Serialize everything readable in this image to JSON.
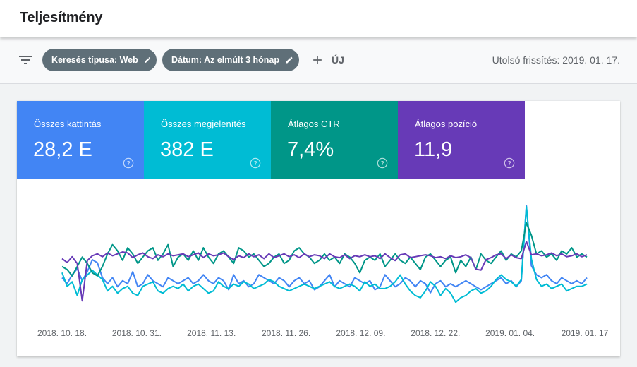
{
  "header": {
    "title": "Teljesítmény"
  },
  "toolbar": {
    "filter_icon": "filter-list-icon",
    "chips": [
      {
        "label": "Keresés típusa: Web",
        "icon": "edit-icon"
      },
      {
        "label": "Dátum: Az elmúlt 3 hónap",
        "icon": "edit-icon"
      }
    ],
    "add_label": "ÚJ",
    "last_updated": "Utolsó frissítés: 2019. 01. 17."
  },
  "metrics": [
    {
      "label": "Összes kattintás",
      "value": "28,2 E",
      "color": "#4285f4"
    },
    {
      "label": "Összes megjelenítés",
      "value": "382 E",
      "color": "#00bcd4"
    },
    {
      "label": "Átlagos CTR",
      "value": "7,4%",
      "color": "#009688"
    },
    {
      "label": "Átlagos pozíció",
      "value": "11,9",
      "color": "#673ab7"
    }
  ],
  "chart_data": {
    "type": "line",
    "x_tick_labels": [
      "2018. 10. 18.",
      "2018. 10. 31.",
      "2018. 11. 13.",
      "2018. 11. 26.",
      "2018. 12. 09.",
      "2018. 12. 22.",
      "2019. 01. 04.",
      "2019. 01. 17"
    ],
    "y_axis_visible": false,
    "grid": false,
    "series": [
      {
        "color": "#4285f4",
        "values": [
          74,
          72,
          75,
          77,
          73,
          76,
          80,
          79,
          74,
          72,
          74,
          71,
          73,
          72,
          76,
          71,
          72,
          75,
          73,
          72,
          71,
          74,
          73,
          72,
          73,
          74,
          72,
          73,
          75,
          73,
          72,
          74,
          73,
          70,
          75,
          72,
          73,
          71,
          72,
          75,
          74,
          73,
          72,
          74,
          73,
          71,
          73,
          74,
          72,
          73,
          70,
          71,
          73,
          75,
          71,
          73,
          72,
          71,
          74,
          73,
          72,
          73,
          70,
          71,
          75,
          73,
          71,
          72,
          74,
          73,
          71,
          73,
          72,
          69,
          72,
          73,
          71,
          72,
          71,
          72,
          73,
          72,
          71,
          70,
          71,
          72,
          73,
          74,
          72,
          73,
          71,
          73,
          98,
          78,
          75,
          74,
          75,
          73,
          72,
          74,
          73,
          72,
          73,
          72,
          74
        ]
      },
      {
        "color": "#00bcd4",
        "values": [
          86,
          80,
          82,
          76,
          83,
          85,
          87,
          85,
          83,
          78,
          80,
          77,
          79,
          80,
          77,
          76,
          80,
          81,
          82,
          78,
          77,
          79,
          80,
          79,
          81,
          78,
          80,
          81,
          79,
          77,
          78,
          82,
          80,
          79,
          81,
          80,
          82,
          81,
          79,
          80,
          81,
          83,
          82,
          80,
          79,
          78,
          79,
          80,
          81,
          80,
          79,
          80,
          81,
          82,
          80,
          79,
          80,
          81,
          80,
          78,
          82,
          80,
          81,
          79,
          79,
          80,
          82,
          85,
          81,
          78,
          76,
          75,
          78,
          82,
          80,
          76,
          79,
          77,
          73,
          75,
          76,
          78,
          79,
          77,
          78,
          80,
          83,
          85,
          83,
          82,
          80,
          83,
          115,
          92,
          83,
          80,
          81,
          79,
          80,
          81,
          78,
          79,
          80,
          80,
          81
        ]
      },
      {
        "color": "#009688",
        "values": [
          88,
          87,
          85,
          88,
          91,
          89,
          86,
          85,
          88,
          92,
          95,
          93,
          90,
          94,
          92,
          89,
          91,
          93,
          94,
          90,
          92,
          95,
          88,
          91,
          92,
          90,
          93,
          90,
          94,
          91,
          89,
          92,
          93,
          91,
          89,
          94,
          93,
          91,
          92,
          90,
          88,
          89,
          91,
          92,
          89,
          90,
          93,
          94,
          92,
          91,
          89,
          90,
          92,
          90,
          91,
          89,
          92,
          91,
          89,
          86,
          90,
          91,
          90,
          92,
          88,
          90,
          92,
          90,
          89,
          91,
          89,
          87,
          91,
          92,
          90,
          88,
          90,
          91,
          86,
          90,
          88,
          91,
          87,
          92,
          90,
          89,
          91,
          93,
          90,
          92,
          91,
          93,
          102,
          98,
          92,
          93,
          91,
          92,
          90,
          93,
          92,
          94,
          91,
          92,
          91
        ]
      },
      {
        "color": "#673ab7",
        "values": [
          11.6,
          12.0,
          11.4,
          12.1,
          16.0,
          11.8,
          11.3,
          11.1,
          11.4,
          11.0,
          11.3,
          11.1,
          10.9,
          11.0,
          11.5,
          11.2,
          11.0,
          11.4,
          11.6,
          11.2,
          11.4,
          11.1,
          11.3,
          11.2,
          11.1,
          11.4,
          11.2,
          11.0,
          11.5,
          11.1,
          11.3,
          11.2,
          11.0,
          11.4,
          11.7,
          11.3,
          11.5,
          11.1,
          11.4,
          11.2,
          11.6,
          11.1,
          11.5,
          11.3,
          11.1,
          11.4,
          11.2,
          11.5,
          11.1,
          11.4,
          11.2,
          11.3,
          11.6,
          11.1,
          11.4,
          11.5,
          11.2,
          11.6,
          11.3,
          11.4,
          11.2,
          11.4,
          11.3,
          11.6,
          11.1,
          11.5,
          11.8,
          11.2,
          11.1,
          11.5,
          11.4,
          11.3,
          11.2,
          11.3,
          11.5,
          11.4,
          11.6,
          11.3,
          11.5,
          11.4,
          11.2,
          11.5,
          12.7,
          12.8,
          11.7,
          11.5,
          11.2,
          11.1,
          11.6,
          11.2,
          11.5,
          11.6,
          9.8,
          11.2,
          11.1,
          11.3,
          11.2,
          11.0,
          11.3,
          11.1,
          11.4,
          11.3,
          11.1,
          11.4,
          11.2
        ]
      }
    ]
  }
}
